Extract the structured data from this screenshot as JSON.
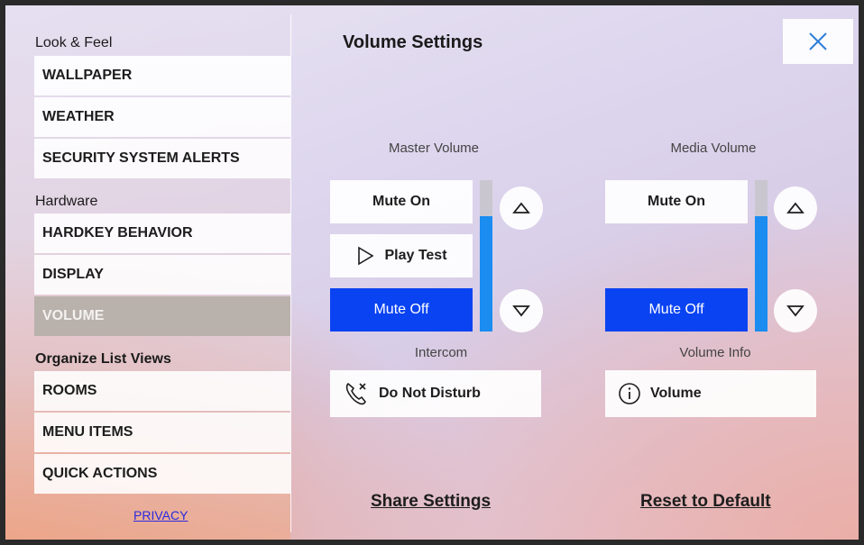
{
  "sidebar": {
    "sections": [
      {
        "title": "Look & Feel"
      },
      {
        "title": "Hardware"
      },
      {
        "title": "Organize List Views"
      }
    ],
    "items": [
      {
        "label": "WALLPAPER"
      },
      {
        "label": "WEATHER"
      },
      {
        "label": "SECURITY SYSTEM ALERTS"
      },
      {
        "label": "HARDKEY BEHAVIOR"
      },
      {
        "label": "DISPLAY"
      },
      {
        "label": "VOLUME",
        "active": true
      },
      {
        "label": "ROOMS"
      },
      {
        "label": "MENU ITEMS"
      },
      {
        "label": "QUICK ACTIONS"
      }
    ],
    "privacy_label": "PRIVACY"
  },
  "panel": {
    "title": "Volume Settings",
    "master": {
      "label": "Master Volume",
      "mute_on_label": "Mute On",
      "play_test_label": "Play Test",
      "mute_off_label": "Mute Off",
      "level": 0.76,
      "selected": "Mute Off"
    },
    "media": {
      "label": "Media Volume",
      "mute_on_label": "Mute On",
      "mute_off_label": "Mute Off",
      "level": 0.76,
      "selected": "Mute Off"
    },
    "intercom": {
      "label": "Intercom",
      "button_label": "Do Not Disturb"
    },
    "volume_info": {
      "label": "Volume Info",
      "button_label": "Volume"
    },
    "share_label": "Share Settings",
    "reset_label": "Reset to Default"
  },
  "colors": {
    "accent_blue": "#0a43f2",
    "slider_blue": "#1b8cf0",
    "active_item": "#b9b1ac",
    "link_blue": "#2a2ae0"
  },
  "icons": {
    "close": "close-icon",
    "play": "play-icon",
    "up": "triangle-up-icon",
    "down": "triangle-down-icon",
    "dnd": "phone-mute-icon",
    "info": "info-icon"
  }
}
